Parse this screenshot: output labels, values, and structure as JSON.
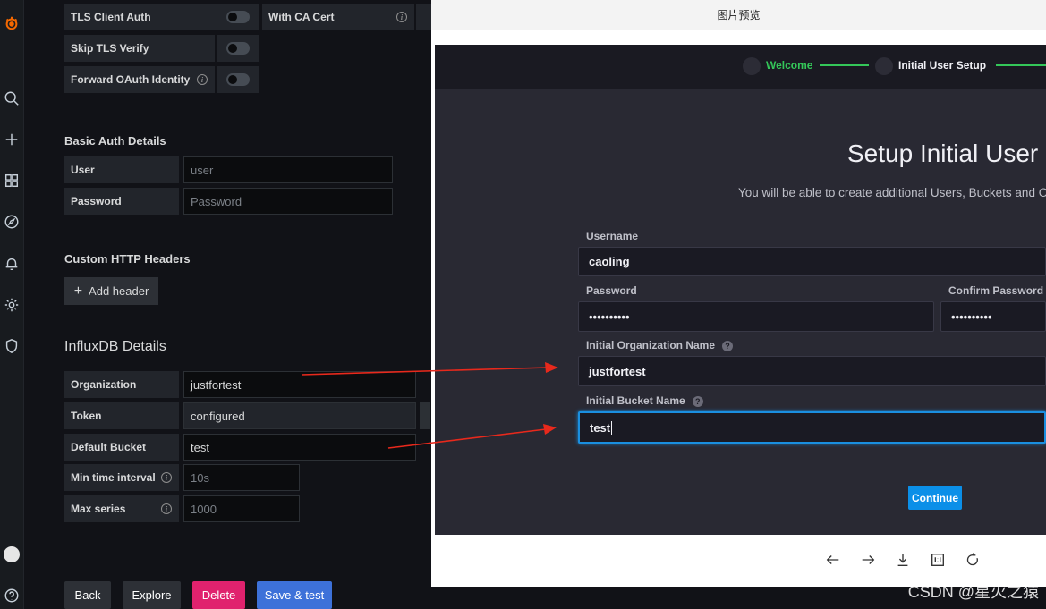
{
  "left_nav": {
    "icons": [
      "grafana-logo-icon",
      "search-icon",
      "plus-icon",
      "dashboards-icon",
      "explore-icon",
      "alert-bell-icon",
      "gear-icon",
      "shield-icon",
      "user-avatar-icon",
      "help-icon"
    ]
  },
  "tls": {
    "client_auth_label": "TLS Client Auth",
    "with_ca_cert_label": "With CA Cert",
    "skip_verify_label": "Skip TLS Verify",
    "forward_oauth_label": "Forward OAuth Identity"
  },
  "basic_auth": {
    "title": "Basic Auth Details",
    "user_label": "User",
    "user_placeholder": "user",
    "password_label": "Password",
    "password_placeholder": "Password"
  },
  "custom_headers": {
    "title": "Custom HTTP Headers",
    "add_label": "Add header"
  },
  "influx": {
    "title": "InfluxDB Details",
    "org_label": "Organization",
    "org_value": "justfortest",
    "token_label": "Token",
    "token_value": "configured",
    "bucket_label": "Default Bucket",
    "bucket_value": "test",
    "min_interval_label": "Min time interval",
    "min_interval_placeholder": "10s",
    "max_series_label": "Max series",
    "max_series_placeholder": "1000"
  },
  "actions": {
    "back": "Back",
    "explore": "Explore",
    "delete": "Delete",
    "save_test": "Save & test"
  },
  "preview": {
    "window_title": "图片预览",
    "steps": [
      "Welcome",
      "Initial User Setup"
    ],
    "heading": "Setup Initial User",
    "subheading": "You will be able to create additional Users, Buckets and Org",
    "username_label": "Username",
    "username_value": "caoling",
    "password_label": "Password",
    "password_value": "••••••••••",
    "confirm_label": "Confirm Password",
    "confirm_value": "••••••••••",
    "org_label": "Initial Organization Name",
    "org_value": "justfortest",
    "bucket_label": "Initial Bucket Name",
    "bucket_value": "test",
    "continue_label": "Continue",
    "toolbar_icons": [
      "arrow-left-icon",
      "arrow-right-icon",
      "download-icon",
      "actual-size-icon",
      "rotate-icon"
    ]
  },
  "watermark": "CSDN @星火之猿",
  "colors": {
    "delete_button": "#e0226e",
    "save_button": "#3d71d9",
    "continue_button": "#0b8fe8",
    "wizard_active": "#34c759",
    "annotation_arrow": "#e8291c"
  }
}
